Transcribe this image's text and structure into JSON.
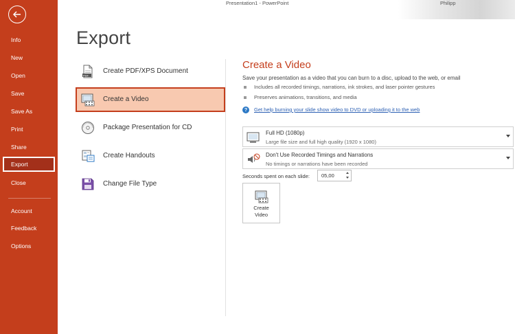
{
  "window": {
    "title": "Presentation1  -  PowerPoint",
    "user": "Philipp"
  },
  "sidebar": {
    "items": [
      {
        "label": "Info"
      },
      {
        "label": "New"
      },
      {
        "label": "Open"
      },
      {
        "label": "Save"
      },
      {
        "label": "Save As"
      },
      {
        "label": "Print"
      },
      {
        "label": "Share"
      },
      {
        "label": "Export"
      },
      {
        "label": "Close"
      },
      {
        "label": "Account"
      },
      {
        "label": "Feedback"
      },
      {
        "label": "Options"
      }
    ],
    "active": "Export",
    "accent": "#c43e1c"
  },
  "page": {
    "title": "Export"
  },
  "export_options": [
    {
      "label": "Create PDF/XPS Document",
      "icon": "pdf-document-icon"
    },
    {
      "label": "Create a Video",
      "icon": "video-icon"
    },
    {
      "label": "Package Presentation for CD",
      "icon": "cd-icon"
    },
    {
      "label": "Create Handouts",
      "icon": "handouts-icon"
    },
    {
      "label": "Change File Type",
      "icon": "save-file-icon"
    }
  ],
  "selected_option": "Create a Video",
  "detail": {
    "title": "Create a Video",
    "description": "Save your presentation as a video that you can burn to a disc, upload to the web, or email",
    "bullets": [
      "Includes all recorded timings, narrations, ink strokes, and laser pointer gestures",
      "Preserves animations, transitions, and media"
    ],
    "help_link": "Get help burning your slide show video to DVD or uploading it to the web",
    "quality_dropdown": {
      "title": "Full HD (1080p)",
      "subtitle": "Large file size and full high quality (1920 x 1080)"
    },
    "timings_dropdown": {
      "title": "Don't Use Recorded Timings and Narrations",
      "subtitle": "No timings or narrations have been recorded"
    },
    "seconds_label": "Seconds spent on each slide:",
    "seconds_value": "05,00",
    "create_button_label": "Create\nVideo"
  },
  "colors": {
    "accent": "#c43e1c",
    "selected_fill": "#f8c9b0",
    "link": "#2b5fb3"
  }
}
